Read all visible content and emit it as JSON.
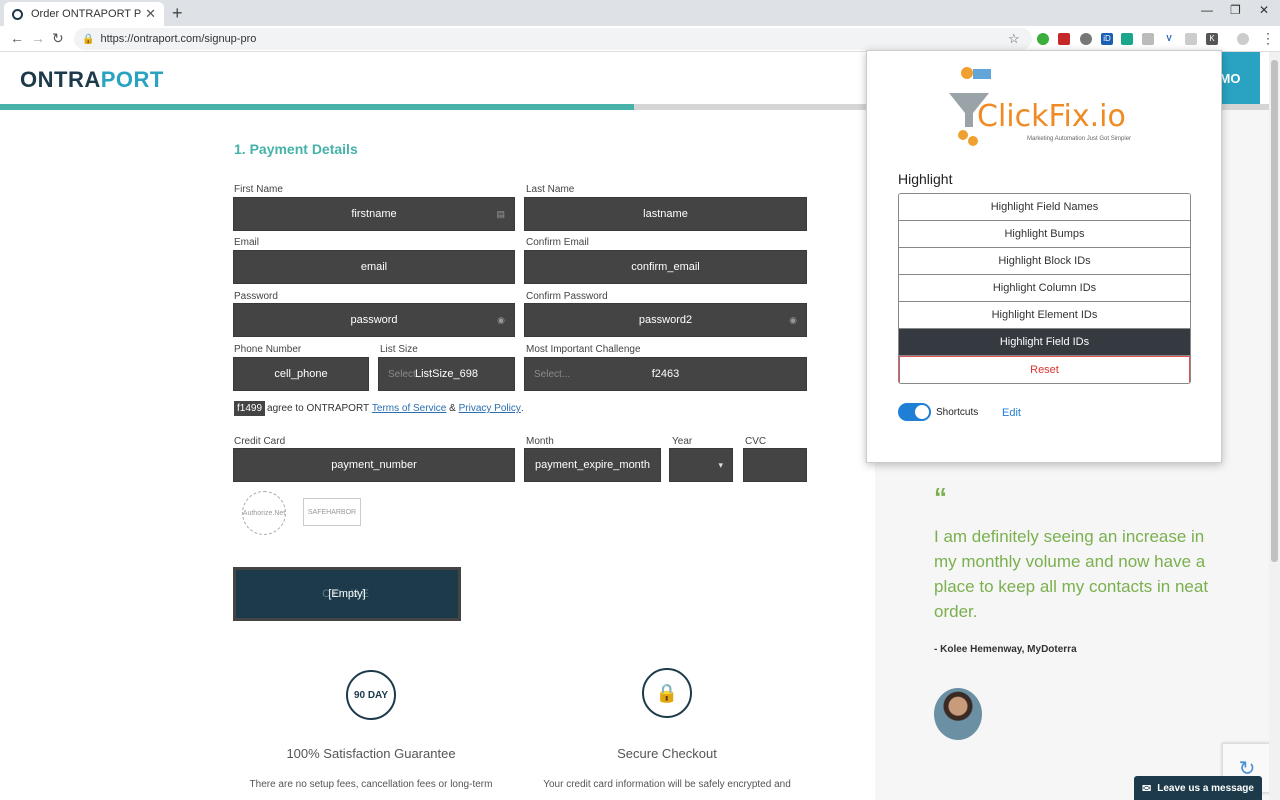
{
  "browser": {
    "tab_title": "Order ONTRAPORT PRO",
    "url": "https://ontraport.com/signup-pro"
  },
  "site": {
    "logo_a": "ONTRA",
    "logo_b": "PORT",
    "demo_label": "MO",
    "progress": 0.495
  },
  "form": {
    "section_title": "1. Payment Details",
    "fields": {
      "first_name": {
        "label": "First Name",
        "value": "firstname"
      },
      "last_name": {
        "label": "Last Name",
        "value": "lastname"
      },
      "email": {
        "label": "Email",
        "value": "email"
      },
      "confirm_email": {
        "label": "Confirm Email",
        "value": "confirm_email"
      },
      "password": {
        "label": "Password",
        "value": "password"
      },
      "confirm_password": {
        "label": "Confirm Password",
        "value": "password2"
      },
      "phone": {
        "label": "Phone Number",
        "value": "cell_phone"
      },
      "list_size": {
        "label": "List Size",
        "placeholder": "Select",
        "value": "ListSize_698"
      },
      "challenge": {
        "label": "Most Important Challenge",
        "placeholder": "Select...",
        "value": "f2463"
      },
      "credit_card": {
        "label": "Credit Card",
        "value": "payment_number"
      },
      "month": {
        "label": "Month",
        "value": "payment_expire_month"
      },
      "year": {
        "label": "Year",
        "value": ""
      },
      "cvc": {
        "label": "CVC",
        "value": ""
      }
    },
    "terms": {
      "badge": "f1499",
      "prefix": "agree to ONTRAPORT",
      "tos": "Terms of Service",
      "amp": "&",
      "privacy": "Privacy Policy",
      "suffix": "."
    },
    "seals": {
      "authorize": "Authorize.Net",
      "safeharbor": "SAFEHARBOR"
    },
    "continue_button": {
      "behind": "CO          UE",
      "label": "[Empty]"
    }
  },
  "guarantees": [
    {
      "icon_text": "90 DAY",
      "title": "100% Satisfaction Guarantee",
      "text": "There are no setup fees, cancellation fees or long-term"
    },
    {
      "icon_text": "",
      "title": "Secure Checkout",
      "text": "Your credit card information will be safely encrypted and"
    }
  ],
  "testimonial": {
    "mark": "“",
    "quote": "I am definitely seeing an increase in my monthly volume and now have a place to keep all my contacts in neat order.",
    "author": "- Kolee Hemenway, MyDoterra"
  },
  "chat": {
    "label": "Leave us a message"
  },
  "clickfix": {
    "brand": "ClickFix.io",
    "tagline": "Marketing Automation Just Got Simpler",
    "highlight_title": "Highlight",
    "buttons": [
      "Highlight Field Names",
      "Highlight Bumps",
      "Highlight Block IDs",
      "Highlight Column IDs",
      "Highlight Element IDs",
      "Highlight Field IDs"
    ],
    "active_index": 5,
    "reset_label": "Reset",
    "shortcuts_label": "Shortcuts",
    "shortcuts_on": true,
    "edit_label": "Edit"
  },
  "colors": {
    "accent_teal": "#46b2a9",
    "brand_dark": "#1c3a4a",
    "brand_blue": "#2aa3c3",
    "quote_green": "#7ab04e",
    "clickfix_orange": "#f08a24"
  }
}
